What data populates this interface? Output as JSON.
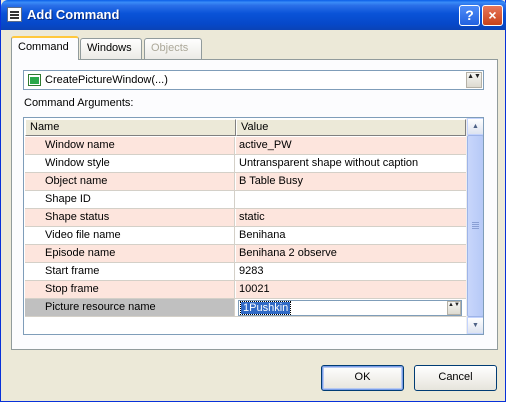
{
  "window": {
    "title": "Add Command",
    "help_label": "?",
    "close_label": "×"
  },
  "tabs": [
    {
      "label": "Command",
      "state": "active"
    },
    {
      "label": "Windows",
      "state": "normal"
    },
    {
      "label": "Objects",
      "state": "disabled"
    }
  ],
  "command_select": {
    "value": "CreatePictureWindow(...)",
    "icon": "green-window-icon",
    "spin_label": "▲▼"
  },
  "arguments": {
    "label": "Command Arguments:",
    "columns": {
      "name": "Name",
      "value": "Value"
    },
    "rows": [
      {
        "name": "Window name",
        "value": "active_PW",
        "highlight": true
      },
      {
        "name": "Window style",
        "value": "Untransparent shape without caption",
        "highlight": false
      },
      {
        "name": "Object name",
        "value": "B Table Busy",
        "highlight": true
      },
      {
        "name": "Shape ID",
        "value": "",
        "highlight": false
      },
      {
        "name": "Shape status",
        "value": "static",
        "highlight": true
      },
      {
        "name": "Video file name",
        "value": "Benihana",
        "highlight": false
      },
      {
        "name": "Episode name",
        "value": "Benihana 2 observe",
        "highlight": true
      },
      {
        "name": "Start frame",
        "value": "9283",
        "highlight": false
      },
      {
        "name": "Stop frame",
        "value": "10021",
        "highlight": true
      },
      {
        "name": "Picture resource name",
        "value": "1Pushkin",
        "highlight": false,
        "selected": true
      }
    ]
  },
  "buttons": {
    "ok": "OK",
    "cancel": "Cancel"
  },
  "colors": {
    "title_bar": "#0a53d8",
    "row_highlight": "#fde5dd",
    "selection": "#316ac5",
    "tab_accent": "#ffc83c"
  }
}
